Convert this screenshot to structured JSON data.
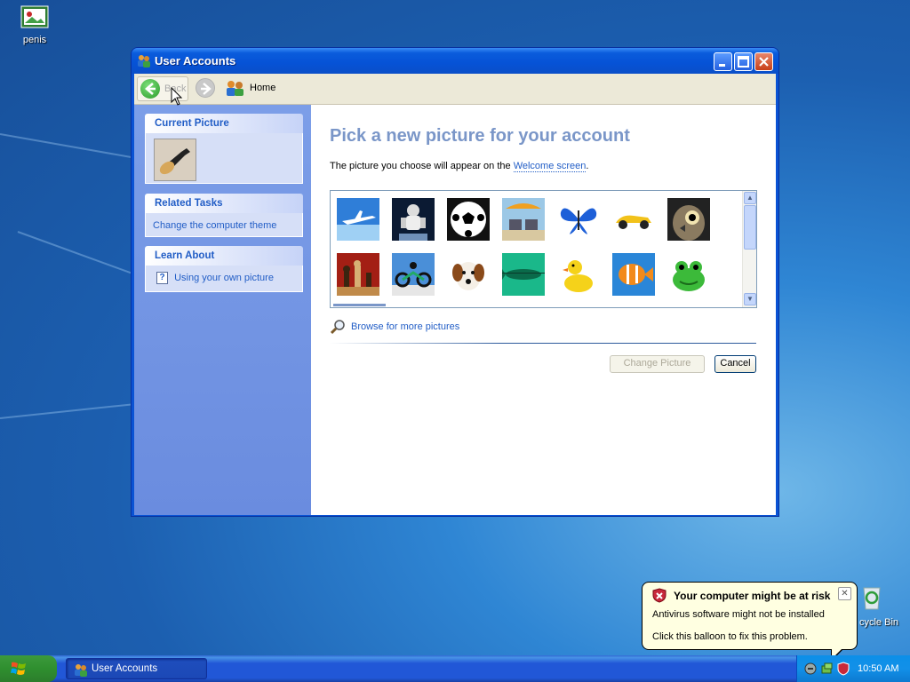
{
  "desktop": {
    "icons": [
      {
        "label": "penis",
        "icon": "document-image-icon"
      },
      {
        "label": "cycle Bin",
        "icon": "recycle-bin-icon"
      }
    ]
  },
  "window": {
    "title": "User Accounts",
    "toolbar": {
      "back_label": "Back",
      "home_label": "Home"
    },
    "left_pane": {
      "current_picture": {
        "title": "Current Picture",
        "picture": "guitar"
      },
      "related_tasks": {
        "title": "Related Tasks",
        "items": [
          "Change the computer theme"
        ]
      },
      "learn_about": {
        "title": "Learn About",
        "items": [
          "Using your own picture"
        ]
      }
    },
    "content": {
      "heading": "Pick a new picture for your account",
      "description_pre": "The picture you choose will appear on the ",
      "description_link": "Welcome screen",
      "description_post": ".",
      "pictures": [
        "airplane",
        "astronaut",
        "soccer ball",
        "beach chairs",
        "butterfly",
        "race car",
        "owl",
        "chess",
        "dirt bike",
        "dog",
        "green fish",
        "rubber duck",
        "orange fish",
        "frog"
      ],
      "browse_label": "Browse for more pictures",
      "change_button": "Change Picture",
      "cancel_button": "Cancel"
    }
  },
  "taskbar": {
    "task_label": "User Accounts",
    "clock": "10:50 AM"
  },
  "balloon": {
    "title": "Your computer might be at risk",
    "line1": "Antivirus software might not be installed",
    "line2": "Click this balloon to fix this problem."
  },
  "colors": {
    "title_bar": "#0652d6",
    "link": "#215dc6",
    "heading": "#7a96c8",
    "left_pane": "#7c9ee8"
  }
}
